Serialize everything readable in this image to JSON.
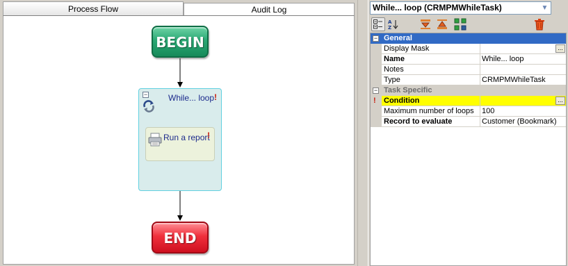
{
  "tabs": [
    {
      "label": "Process Flow",
      "active": true
    },
    {
      "label": "Audit Log",
      "active": false
    }
  ],
  "flow": {
    "begin_label": "BEGIN",
    "end_label": "END",
    "loop_title": "While... loop",
    "loop_collapse_symbol": "−",
    "task_label": "Run a report",
    "warning_symbol": "!",
    "colors": {
      "begin": "#1f9e6b",
      "end": "#e8222e",
      "loop_bg": "#d9ecec",
      "task_bg": "#ecf2dc",
      "label": "#1c2a8c"
    }
  },
  "property_panel": {
    "selector_value": "While... loop (CRMPMWhileTask)",
    "toolbar": [
      {
        "icon": "categorized-view-icon"
      },
      {
        "icon": "alphabetical-sort-icon"
      },
      {
        "icon": "move-down-icon"
      },
      {
        "icon": "move-up-icon"
      },
      {
        "icon": "add-items-icon"
      },
      {
        "icon": "delete-icon"
      }
    ],
    "categories": [
      {
        "name": "General",
        "expand_symbol": "−",
        "properties": [
          {
            "name": "Display Mask",
            "value": "",
            "has_ellipsis": true
          },
          {
            "name": "Name",
            "value": "While... loop",
            "bold": true
          },
          {
            "name": "Notes",
            "value": ""
          },
          {
            "name": "Type",
            "value": "CRMPMWhileTask"
          }
        ]
      },
      {
        "name": "Task Specific",
        "expand_symbol": "−",
        "properties": [
          {
            "name": "Condition",
            "value": "",
            "bold": true,
            "highlight": true,
            "warning": true,
            "has_ellipsis": true
          },
          {
            "name": "Maximum number of loops",
            "value": "100"
          },
          {
            "name": "Record to evaluate",
            "value": "Customer (Bookmark)",
            "bold": true
          }
        ]
      }
    ],
    "ellipsis_label": "...",
    "warning_symbol": "!",
    "dropdown_symbol": "▼",
    "colors": {
      "selection": "#316ac5",
      "highlight": "#ffff00",
      "warning": "#c81e10"
    }
  }
}
